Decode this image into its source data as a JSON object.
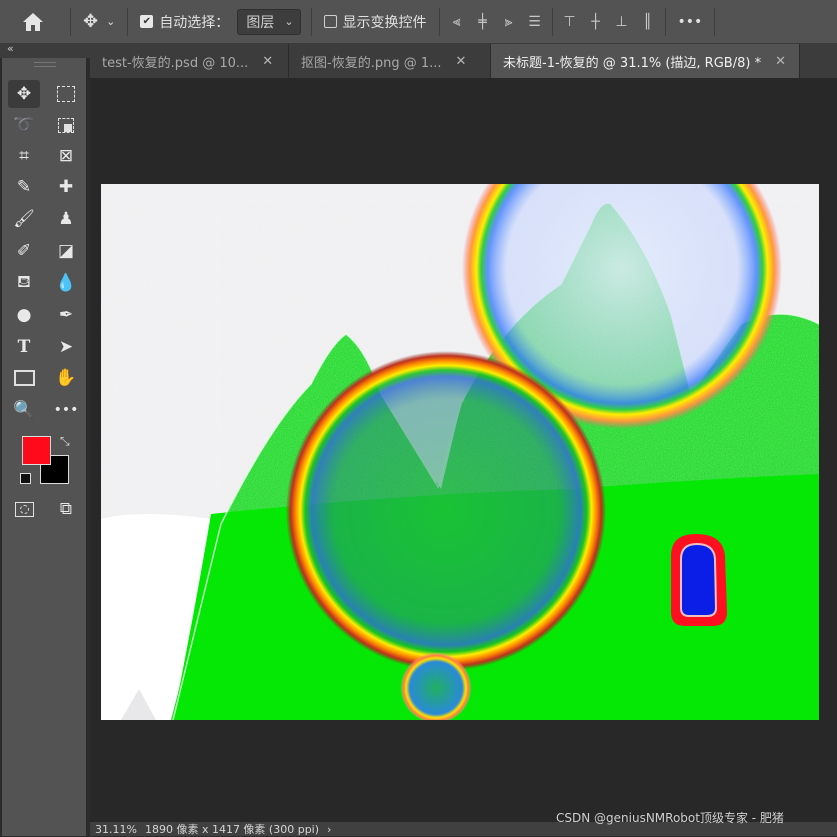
{
  "options_bar": {
    "auto_select_label": "自动选择：",
    "auto_select_value": "图层",
    "show_transform_label": "显示变换控件",
    "more_label": "•••"
  },
  "tabs": [
    {
      "label": "test-恢复的.psd @ 10...",
      "close": "✕"
    },
    {
      "label": "抠图-恢复的.png @ 1...",
      "close": "✕"
    },
    {
      "label": "未标题-1-恢复的 @ 31.1% (描边, RGB/8) *",
      "close": "✕"
    }
  ],
  "colors": {
    "foreground": "#ff0a1a",
    "background": "#000000"
  },
  "status": {
    "zoom": "31.11%",
    "doc_info": "1890 像素 x 1417 像素 (300 ppi)",
    "arrow": "›"
  },
  "watermark": "CSDN @geniusNMRobot顶级专家 - 肥猪"
}
